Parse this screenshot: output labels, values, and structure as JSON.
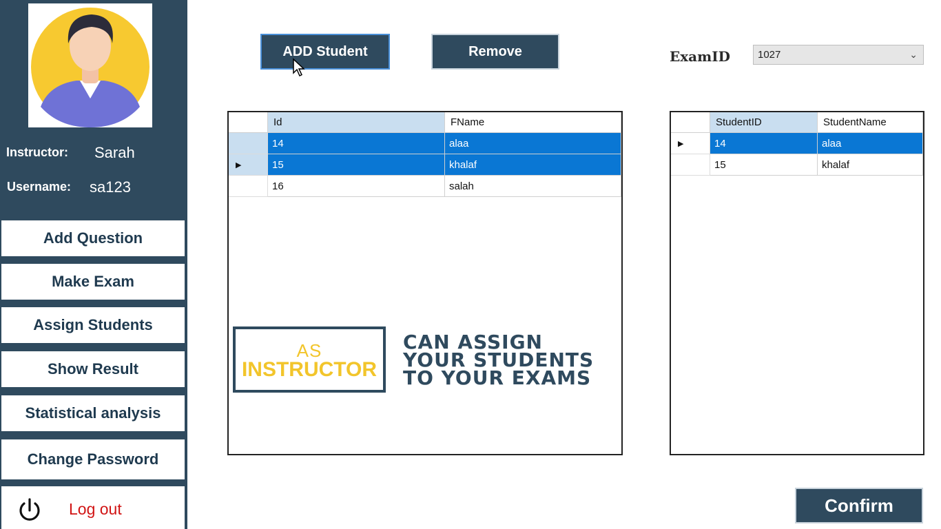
{
  "sidebar": {
    "instructor_label": "Instructor:",
    "instructor_name": "Sarah",
    "username_label": "Username:",
    "username_value": "sa123",
    "nav": {
      "add_question": "Add Question",
      "make_exam": "Make Exam",
      "assign_students": "Assign Students",
      "show_result": "Show Result",
      "statistical_analysis": "Statistical analysis",
      "change_password": "Change Password",
      "log_out": "Log out"
    }
  },
  "toolbar": {
    "add_student_label": "ADD Student",
    "remove_label": "Remove",
    "examid_label": "ExamID",
    "examid_value": "1027"
  },
  "students_grid": {
    "columns": [
      "Id",
      "FName"
    ],
    "rows": [
      {
        "id": "14",
        "fname": "alaa"
      },
      {
        "id": "15",
        "fname": "khalaf"
      },
      {
        "id": "16",
        "fname": "salah"
      }
    ]
  },
  "assigned_grid": {
    "columns": [
      "StudentID",
      "StudentName"
    ],
    "rows": [
      {
        "id": "14",
        "name": "alaa"
      },
      {
        "id": "15",
        "name": "khalaf"
      }
    ]
  },
  "overlay": {
    "as": "AS",
    "instructor": "INSTRUCTOR",
    "line1": "CAN ASSIGN",
    "line2": "YOUR STUDENTS",
    "line3": "TO YOUR EXAMS"
  },
  "confirm_label": "Confirm",
  "colors": {
    "sidebar": "#2f4a5e",
    "selection": "#0a77d4",
    "accent_yellow": "#f2c52b",
    "logout_red": "#d11414"
  },
  "icons": [
    "avatar",
    "power-icon",
    "chevron-down-icon",
    "row-pointer-icon",
    "mouse-cursor-icon"
  ]
}
